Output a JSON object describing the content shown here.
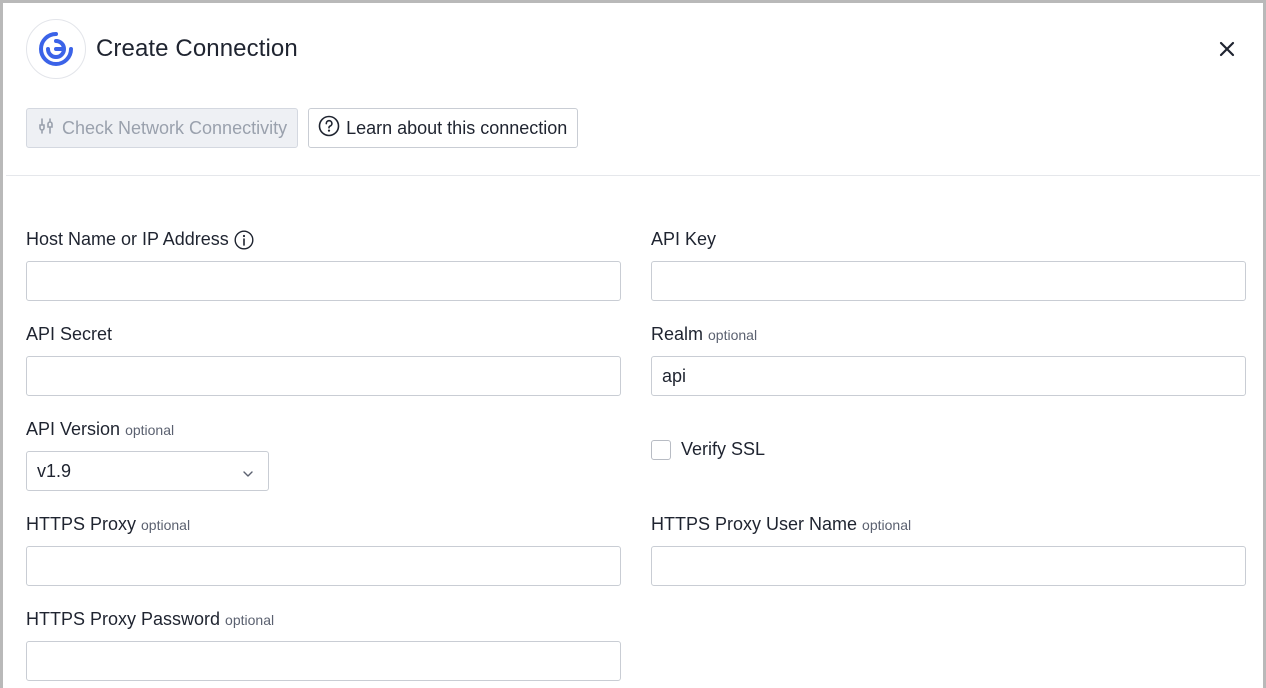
{
  "dialog": {
    "title": "Create Connection",
    "logo_icon": "connector-logo-icon",
    "close_icon": "close-icon"
  },
  "toolbar": {
    "check_connectivity_label": "Check Network Connectivity",
    "check_connectivity_icon": "network-plug-icon",
    "learn_label": "Learn about this connection",
    "learn_icon": "question-circle-icon"
  },
  "fields": {
    "host": {
      "label": "Host Name or IP Address",
      "value": "",
      "info_icon": "info-icon"
    },
    "api_key": {
      "label": "API Key",
      "value": ""
    },
    "api_secret": {
      "label": "API Secret",
      "value": ""
    },
    "realm": {
      "label": "Realm",
      "optional": "optional",
      "value": "api"
    },
    "api_version": {
      "label": "API Version",
      "optional": "optional",
      "value": "v1.9",
      "chevron_icon": "chevron-down-icon"
    },
    "verify_ssl": {
      "label": "Verify SSL",
      "checked": false
    },
    "https_proxy": {
      "label": "HTTPS Proxy",
      "optional": "optional",
      "value": ""
    },
    "https_proxy_user": {
      "label": "HTTPS Proxy User Name",
      "optional": "optional",
      "value": ""
    },
    "https_proxy_password": {
      "label": "HTTPS Proxy Password",
      "optional": "optional",
      "value": ""
    }
  },
  "colors": {
    "brand_blue": "#3b63e8",
    "text": "#1f2430",
    "border": "#c9cdd4",
    "disabled_bg": "#eef0f4",
    "disabled_text": "#9aa1ad"
  }
}
